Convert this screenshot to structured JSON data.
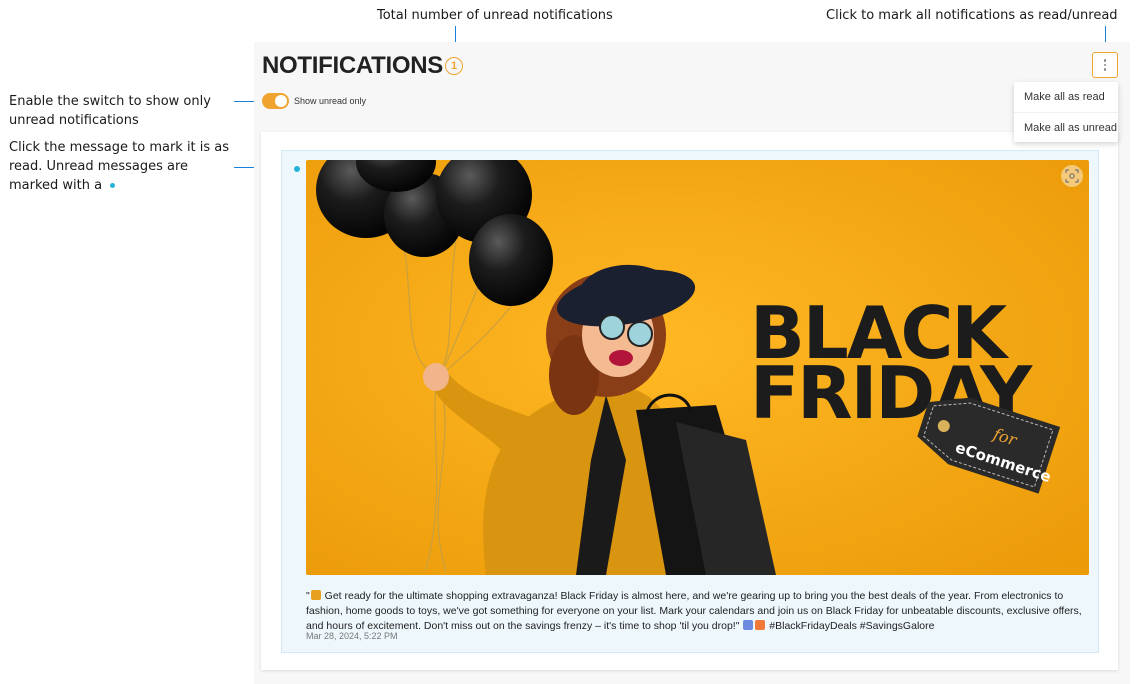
{
  "callouts": {
    "unread_total": "Total number of unread notifications",
    "mark_all": "Click to mark all notifications as read/unread",
    "switch_line1": "Enable the switch to show only",
    "switch_line2": "unread notifications",
    "message_line1": "Click the message to mark it is as",
    "message_line2": "read. Unread messages are",
    "message_line3": "marked with  a"
  },
  "header": {
    "title": "NOTIFICATIONS",
    "unread_count": "1"
  },
  "filter": {
    "label": "Show unread only",
    "enabled": true
  },
  "menu": {
    "items": [
      "Make all as read",
      "Make all as unread"
    ]
  },
  "notification": {
    "unread": true,
    "banner": {
      "headline_line1": "BLACK",
      "headline_line2": "FRIDAY",
      "tag_line1": "for",
      "tag_line2": "eCommerce"
    },
    "message_part1": "\"",
    "message_part2": " Get ready for the ultimate shopping extravaganza! Black Friday is almost here, and we're gearing up to bring you the best deals of the year. From electronics to fashion, home goods to toys, we've got something for everyone on your list. Mark your calendars and join us on Black Friday for unbeatable discounts, exclusive offers, and hours of excitement. Don't miss out on the savings frenzy – it's time to shop 'til you drop!\"",
    "message_part3": " #BlackFridayDeals #SavingsGalore",
    "timestamp": "Mar 28, 2024, 5:22 PM"
  },
  "colors": {
    "accent": "#f0a430",
    "unread_dot": "#26b3d9",
    "callout_line": "#1a82d6",
    "banner_bg": "#f5a712"
  },
  "icons": [
    "kebab-menu-icon",
    "toggle-switch",
    "unread-dot-icon",
    "scan-icon",
    "party-popper-emoji",
    "shopping-bags-emoji",
    "gift-emoji"
  ]
}
